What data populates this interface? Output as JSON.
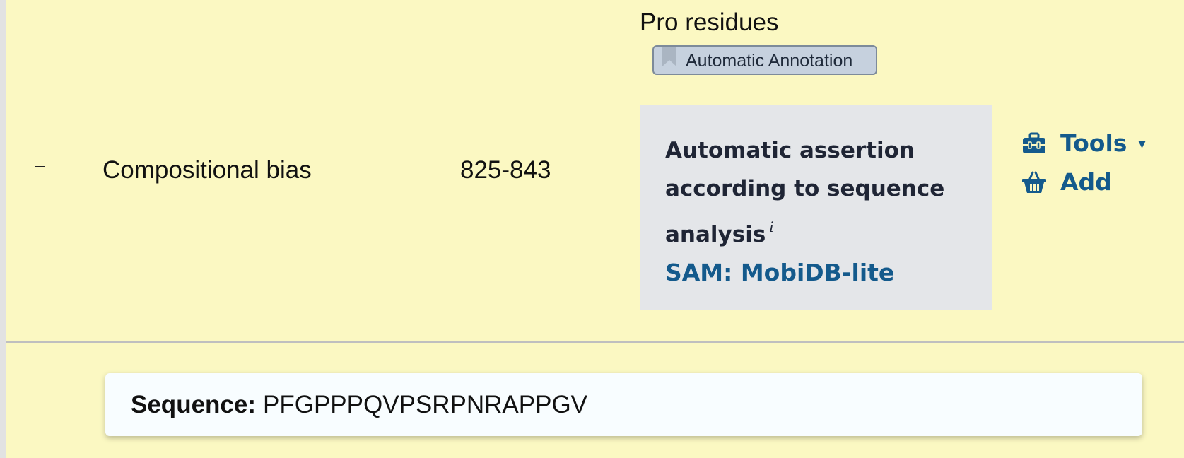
{
  "feature_row": {
    "collapse_symbol": "–",
    "type": "Compositional bias",
    "position": "825-843",
    "description": "Pro residues",
    "tag": {
      "label": "Automatic Annotation",
      "icon": "bookmark-icon",
      "color": "#c6d1de"
    },
    "evidence": {
      "text": "Automatic assertion according to sequence analysis",
      "info_marker": "i",
      "source_link": "SAM: MobiDB-lite",
      "background": "#e4e6e9"
    },
    "actions": {
      "tools_label": "Tools",
      "tools_icon": "toolbox-icon",
      "tools_caret": "▾",
      "add_label": "Add",
      "add_icon": "basket-icon"
    }
  },
  "sequence": {
    "label": "Sequence:",
    "value": "PFGPPPQVPSRPNRAPPGV"
  },
  "colors": {
    "row_background": "#fbf8c2",
    "link": "#145a8c"
  }
}
